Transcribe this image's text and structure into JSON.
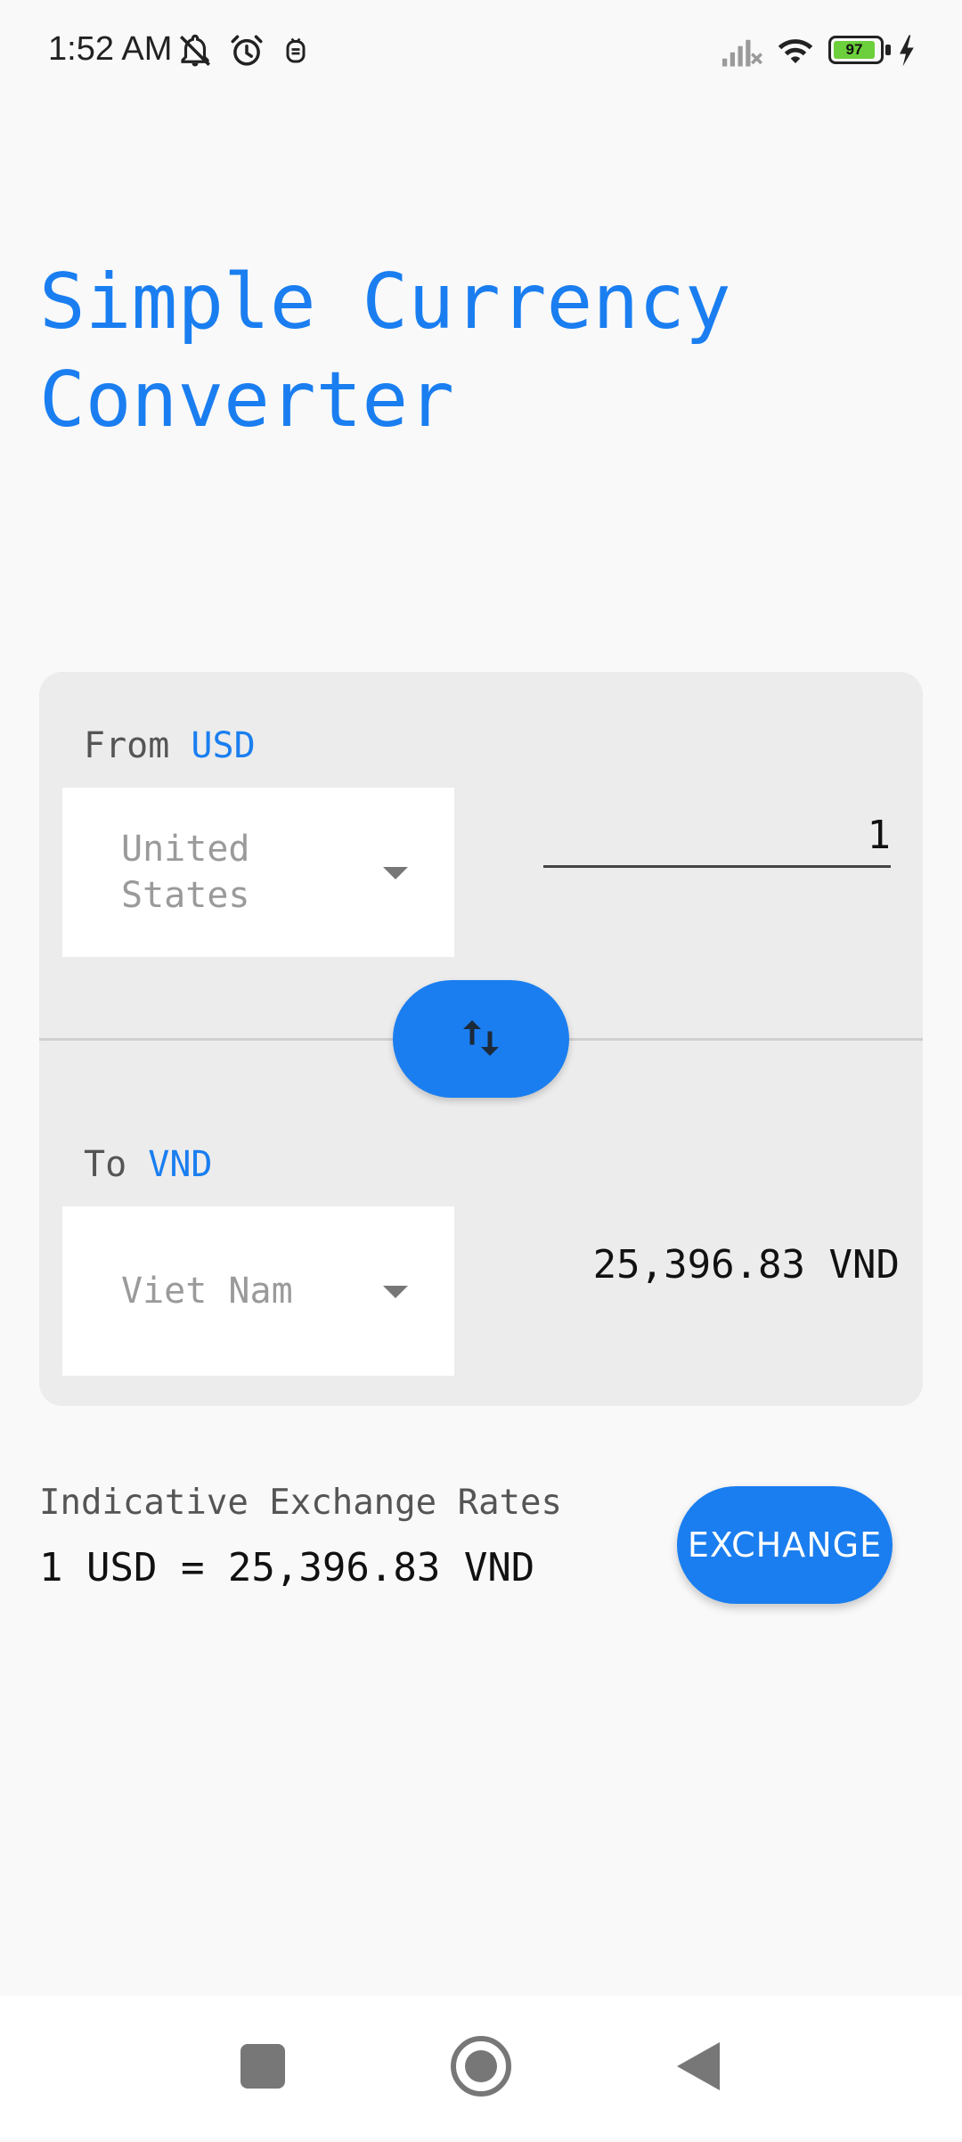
{
  "status_bar": {
    "time": "1:52 AM",
    "battery_level": "97",
    "icons": [
      "notifications-off-icon",
      "alarm-icon",
      "app-notification-icon",
      "signal-icon",
      "wifi-icon",
      "battery-icon",
      "charging-icon"
    ]
  },
  "app": {
    "title": "Simple Currency Converter"
  },
  "from": {
    "label": "From",
    "code": "USD",
    "country": "United States",
    "amount": "1"
  },
  "to": {
    "label": "To",
    "code": "VND",
    "country": "Viet Nam",
    "result": "25,396.83 VND"
  },
  "rates": {
    "label": "Indicative Exchange Rates",
    "value": "1 USD = 25,396.83 VND"
  },
  "actions": {
    "exchange_label": "EXCHANGE",
    "swap_icon": "swap-vertical-icon"
  },
  "nav": {
    "icons": [
      "recents-icon",
      "home-icon",
      "back-icon"
    ]
  },
  "colors": {
    "accent": "#1a7ef0",
    "card_background": "#ececec",
    "page_background": "#f9f9f9",
    "battery_fill": "#6ccf3c"
  }
}
